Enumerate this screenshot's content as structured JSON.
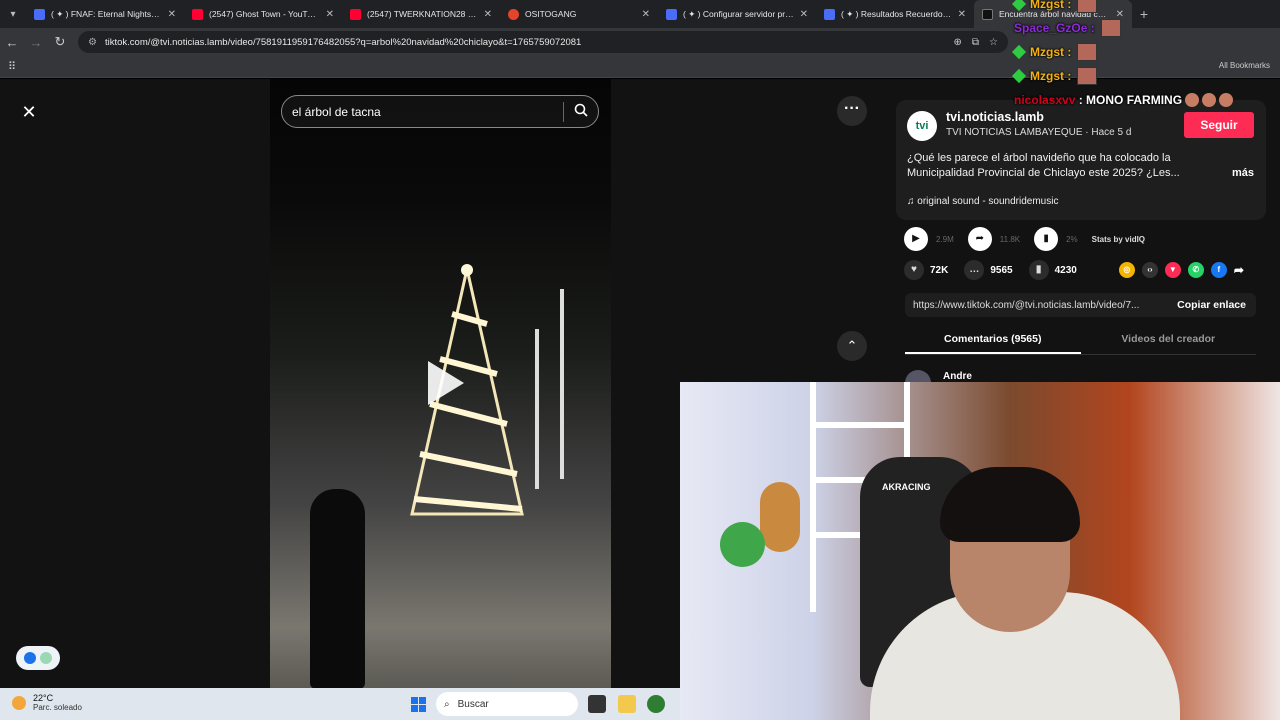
{
  "browser": {
    "tabs": [
      {
        "title": "( ✦ ) FNAF: Eternal Nights 🌧 - R",
        "color": "#4a6cf7"
      },
      {
        "title": "(2547) Ghost Town - YouTube",
        "color": "#ff0033"
      },
      {
        "title": "(2547) TWERKNATION28 - N",
        "color": "#ff0033"
      },
      {
        "title": "OSITOGANG",
        "color": "#e2452b"
      },
      {
        "title": "( ✦ ) Configurar servidor privad",
        "color": "#4a6cf7"
      },
      {
        "title": "( ✦ ) Resultados Recuerdos v0.",
        "color": "#4a6cf7"
      },
      {
        "title": "Encuentra árbol navidad chicl",
        "color": "#111111"
      }
    ],
    "url": "tiktok.com/@tvi.noticias.lamb/video/7581911959176482055?q=arbol%20navidad%20chiclayo&t=1765759072081",
    "all_bookmarks": "All Bookmarks"
  },
  "video": {
    "search_query": "el árbol de tacna"
  },
  "post": {
    "username": "tvi.noticias.lamb",
    "avatar_text": "tvi",
    "subtitle": "TVI NOTICIAS LAMBAYEQUE · Hace 5 d",
    "follow_label": "Seguir",
    "description": "¿Qué les parece el árbol navideño que ha colocado la Municipalidad Provincial de Chiclayo este 2025? ¿Les...",
    "more_label": "más",
    "sound": "original sound - soundridemusic",
    "plays": "2.9M",
    "shares_stat": "11.8K",
    "engagement": "2%",
    "stats_label": "Stats by vidIQ",
    "likes": "72K",
    "comments": "9565",
    "saves": "4230",
    "link": "https://www.tiktok.com/@tvi.noticias.lamb/video/7...",
    "copy_label": "Copiar enlace",
    "tab_comments": "Comentarios (9565)",
    "tab_creator": "Videos del creador",
    "first_commenter": "Andre"
  },
  "chat": [
    {
      "user": "Mzgst",
      "text": ""
    },
    {
      "user": "Space_GzOe",
      "text": ""
    },
    {
      "user": "Mzgst",
      "text": ""
    },
    {
      "user": "Mzgst",
      "text": ""
    },
    {
      "user": "nicolasxvv",
      "text": "MONO FARMING"
    }
  ],
  "webcam": {
    "chair_brand": "AKRACING"
  },
  "taskbar": {
    "temp": "22°C",
    "weather": "Parc. soleado",
    "search_placeholder": "Buscar"
  }
}
